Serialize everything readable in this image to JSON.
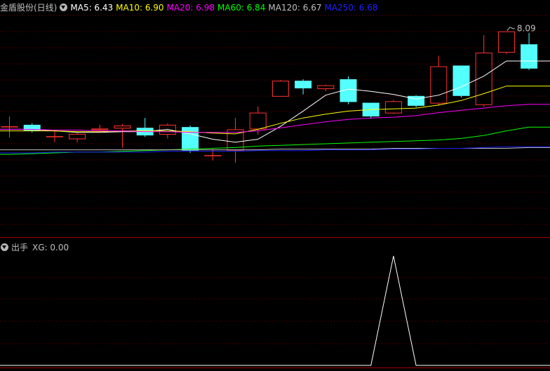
{
  "header": {
    "stock_name": "金盾股份(日线)",
    "indicators": [
      {
        "label": "MA5: 6.43",
        "color": "#ffffff"
      },
      {
        "label": "MA10: 6.90",
        "color": "#ffff00"
      },
      {
        "label": "MA20: 6.98",
        "color": "#ff00ff"
      },
      {
        "label": "MA60: 6.84",
        "color": "#00ff00"
      },
      {
        "label": "MA120: 6.67",
        "color": "#c0c0c0"
      },
      {
        "label": "MA250: 6.68",
        "color": "#2020ff"
      }
    ]
  },
  "sub_header": {
    "title": "出手",
    "xg_label": "XG: 0.00"
  },
  "colors": {
    "background": "#000000",
    "grid": "#7a0000",
    "up": "#ff3232",
    "down": "#54ffff",
    "text": "#c0c0c0"
  },
  "chart_data": [
    {
      "type": "candlestick",
      "title": "金盾股份(日线)",
      "high_annotation": "8.09",
      "ylim": [
        5.4,
        8.3
      ],
      "candles": [
        {
          "o": 6.84,
          "c": 6.84,
          "h": 6.97,
          "l": 6.69
        },
        {
          "o": 6.86,
          "c": 6.78,
          "h": 6.88,
          "l": 6.76
        },
        {
          "o": 6.71,
          "c": 6.71,
          "h": 6.79,
          "l": 6.63
        },
        {
          "o": 6.67,
          "c": 6.74,
          "h": 6.76,
          "l": 6.63
        },
        {
          "o": 6.79,
          "c": 6.81,
          "h": 6.86,
          "l": 6.77
        },
        {
          "o": 6.81,
          "c": 6.85,
          "h": 6.87,
          "l": 6.56
        },
        {
          "o": 6.82,
          "c": 6.72,
          "h": 6.95,
          "l": 6.7
        },
        {
          "o": 6.73,
          "c": 6.86,
          "h": 6.88,
          "l": 6.68
        },
        {
          "o": 6.83,
          "c": 6.52,
          "h": 6.85,
          "l": 6.49
        },
        {
          "o": 6.46,
          "c": 6.46,
          "h": 6.54,
          "l": 6.39
        },
        {
          "o": 6.52,
          "c": 6.8,
          "h": 6.95,
          "l": 6.36
        },
        {
          "o": 6.8,
          "c": 7.02,
          "h": 7.1,
          "l": 6.73
        },
        {
          "o": 7.23,
          "c": 7.44,
          "h": 7.45,
          "l": 7.23
        },
        {
          "o": 7.44,
          "c": 7.34,
          "h": 7.46,
          "l": 7.26
        },
        {
          "o": 7.33,
          "c": 7.38,
          "h": 7.39,
          "l": 7.3
        },
        {
          "o": 7.46,
          "c": 7.16,
          "h": 7.5,
          "l": 7.13
        },
        {
          "o": 7.15,
          "c": 6.97,
          "h": 7.15,
          "l": 6.94
        },
        {
          "o": 7.01,
          "c": 7.17,
          "h": 7.19,
          "l": 7.0
        },
        {
          "o": 7.24,
          "c": 7.11,
          "h": 7.25,
          "l": 7.09
        },
        {
          "o": 7.14,
          "c": 7.63,
          "h": 7.77,
          "l": 7.11
        },
        {
          "o": 7.64,
          "c": 7.24,
          "h": 7.64,
          "l": 7.22
        },
        {
          "o": 7.12,
          "c": 7.81,
          "h": 8.04,
          "l": 7.1
        },
        {
          "o": 7.81,
          "c": 8.09,
          "h": 8.09,
          "l": 7.79
        },
        {
          "o": 7.92,
          "c": 7.6,
          "h": 8.07,
          "l": 7.58
        }
      ],
      "ma_lines": [
        {
          "name": "MA5",
          "color": "#ffffff",
          "values": [
            6.8,
            6.8,
            6.78,
            6.76,
            6.76,
            6.77,
            6.77,
            6.8,
            6.74,
            6.67,
            6.63,
            6.67,
            6.84,
            7.04,
            7.25,
            7.33,
            7.3,
            7.26,
            7.2,
            7.25,
            7.36,
            7.5,
            7.7,
            7.7
          ]
        },
        {
          "name": "MA10",
          "color": "#ffff00",
          "values": [
            6.78,
            6.78,
            6.78,
            6.77,
            6.77,
            6.78,
            6.78,
            6.78,
            6.77,
            6.75,
            6.74,
            6.8,
            6.88,
            6.95,
            7.0,
            7.04,
            7.06,
            7.07,
            7.08,
            7.12,
            7.18,
            7.27,
            7.37,
            7.37
          ]
        },
        {
          "name": "MA20",
          "color": "#ff00ff",
          "values": [
            6.8,
            6.8,
            6.79,
            6.79,
            6.78,
            6.78,
            6.77,
            6.77,
            6.76,
            6.76,
            6.76,
            6.78,
            6.82,
            6.86,
            6.9,
            6.93,
            6.95,
            6.96,
            6.98,
            7.02,
            7.05,
            7.08,
            7.11,
            7.13
          ]
        },
        {
          "name": "MA60",
          "color": "#00ff00",
          "values": [
            6.47,
            6.48,
            6.49,
            6.5,
            6.5,
            6.51,
            6.52,
            6.53,
            6.54,
            6.55,
            6.56,
            6.58,
            6.59,
            6.6,
            6.61,
            6.62,
            6.63,
            6.64,
            6.65,
            6.66,
            6.68,
            6.72,
            6.78,
            6.83
          ]
        },
        {
          "name": "MA120",
          "color": "#c0c0c0",
          "values": [
            6.53,
            6.53,
            6.53,
            6.53,
            6.53,
            6.53,
            6.53,
            6.53,
            6.53,
            6.53,
            6.53,
            6.53,
            6.54,
            6.54,
            6.54,
            6.54,
            6.54,
            6.55,
            6.55,
            6.55,
            6.55,
            6.55,
            6.55,
            6.56
          ]
        },
        {
          "name": "MA250",
          "color": "#2020ff",
          "values": [
            6.49,
            6.49,
            6.5,
            6.5,
            6.5,
            6.5,
            6.5,
            6.51,
            6.51,
            6.51,
            6.51,
            6.52,
            6.52,
            6.52,
            6.53,
            6.53,
            6.53,
            6.54,
            6.54,
            6.55,
            6.55,
            6.56,
            6.57,
            6.57
          ]
        }
      ]
    },
    {
      "type": "line",
      "title": "出手",
      "series": [
        {
          "name": "XG",
          "values": [
            0,
            0,
            0,
            0,
            0,
            0,
            0,
            0,
            0,
            0,
            0,
            0,
            0,
            0,
            0,
            0,
            0,
            1,
            0,
            0,
            0,
            0,
            0,
            0
          ]
        }
      ],
      "ylim": [
        0,
        1
      ]
    }
  ]
}
